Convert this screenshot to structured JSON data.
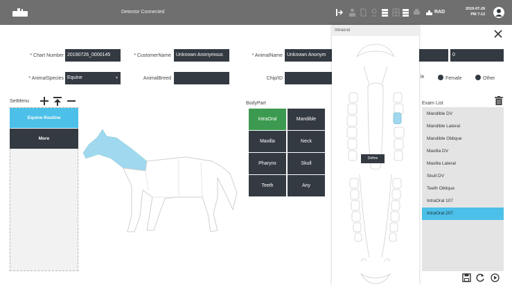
{
  "topbar": {
    "status": "Detector  Connected",
    "mode": "RAD",
    "date": "2019-07-26",
    "time": "PM 7:12",
    "icons": [
      "exposure-icon",
      "person-icon",
      "document-icon",
      "search-person-icon",
      "stack-icon",
      "grid-icon",
      "stack2-icon",
      "print-icon",
      "rad-icon",
      "user-icon"
    ]
  },
  "form": {
    "chart_number_label": "* Chart Number",
    "chart_number": "20190726_0000145",
    "customer_name_label": "* CustomerName",
    "customer_name": "Unknown Anonymous",
    "animal_name_label": "* AnimalName",
    "animal_name": "Unknown Anonym",
    "extra_field_value": "0",
    "animal_species_label": "* AnimalSpecies",
    "animal_species": "Equine",
    "animal_breed_label": "AnimalBreed",
    "animal_breed": "",
    "chip_id_label": "Chip/ID",
    "chip_id": "",
    "sex_partial": "le",
    "sex_female": "Female",
    "sex_other": "Other"
  },
  "setmenu": {
    "label": "SetMenu",
    "items": [
      {
        "label": "Equine Routine",
        "color": "#4cc0e8"
      },
      {
        "label": "More",
        "color": "#333a42"
      }
    ]
  },
  "bodypart": {
    "label": "BodyPart",
    "items": [
      "IntraOral",
      "Mandible",
      "Maxilla",
      "Neck",
      "Pharynx",
      "Skull",
      "Teeth",
      "Any"
    ],
    "active": "IntraOral"
  },
  "intraoral": {
    "title": "Intraoral",
    "define": "Define"
  },
  "exam_list": {
    "label": "Exam List",
    "items": [
      "Mandible DV",
      "Mandible Lateral",
      "Mandible Oblique",
      "Maxilla DV",
      "Maxilla Lateral",
      "Skull DV",
      "Teeth Oblique",
      "IntraOral 107",
      "IntraOral 207"
    ],
    "selected": "IntraOral 207"
  },
  "colors": {
    "topbar": "#6f6f6f",
    "field": "#333a42",
    "accent": "#4cc0e8",
    "active_green": "#3b9a4f"
  }
}
